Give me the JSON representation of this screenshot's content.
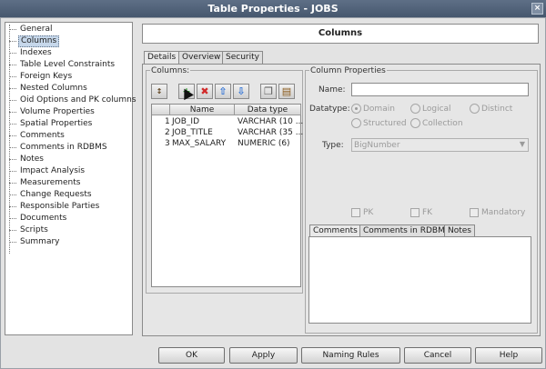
{
  "window": {
    "title": "Table Properties - JOBS"
  },
  "nav": {
    "items": [
      "General",
      "Columns",
      "Indexes",
      "Table Level Constraints",
      "Foreign Keys",
      "Nested Columns",
      "Oid Options and PK columns",
      "Volume Properties",
      "Spatial Properties",
      "Comments",
      "Comments in RDBMS",
      "Notes",
      "Impact Analysis",
      "Measurements",
      "Change Requests",
      "Responsible Parties",
      "Documents",
      "Scripts",
      "Summary"
    ],
    "selected": "Columns"
  },
  "section": {
    "title": "Columns"
  },
  "tabs": [
    "Details",
    "Overview",
    "Security"
  ],
  "columns_group": {
    "label": "Columns:",
    "toolbar": [
      "sort-icon",
      "add-icon",
      "delete-icon",
      "move-up-icon",
      "move-down-icon",
      "copy-icon",
      "paste-icon"
    ],
    "headers": [
      "Name",
      "Data type"
    ],
    "rows": [
      {
        "num": "1",
        "name": "JOB_ID",
        "type": "VARCHAR (10 ..."
      },
      {
        "num": "2",
        "name": "JOB_TITLE",
        "type": "VARCHAR (35 ..."
      },
      {
        "num": "3",
        "name": "MAX_SALARY",
        "type": "NUMERIC (6)"
      }
    ]
  },
  "properties": {
    "label": "Column Properties",
    "name_label": "Name:",
    "name_value": "",
    "datatype_label": "Datatype:",
    "datatype_options": [
      "Domain",
      "Logical",
      "Distinct",
      "Structured",
      "Collection"
    ],
    "datatype_selected": "Domain",
    "type_label": "Type:",
    "type_value": "BigNumber",
    "checks": [
      "PK",
      "FK",
      "Mandatory"
    ],
    "subtabs": [
      "Comments",
      "Comments in RDBMS",
      "Notes"
    ]
  },
  "buttons": {
    "ok": "OK",
    "apply": "Apply",
    "naming": "Naming Rules",
    "cancel": "Cancel",
    "help": "Help"
  },
  "colors": {
    "titlebar": "#4f6078",
    "selection": "#c6d7ea",
    "add": "#2f9e2f",
    "delete": "#d12a2a",
    "arrows": "#2a6fd6"
  }
}
